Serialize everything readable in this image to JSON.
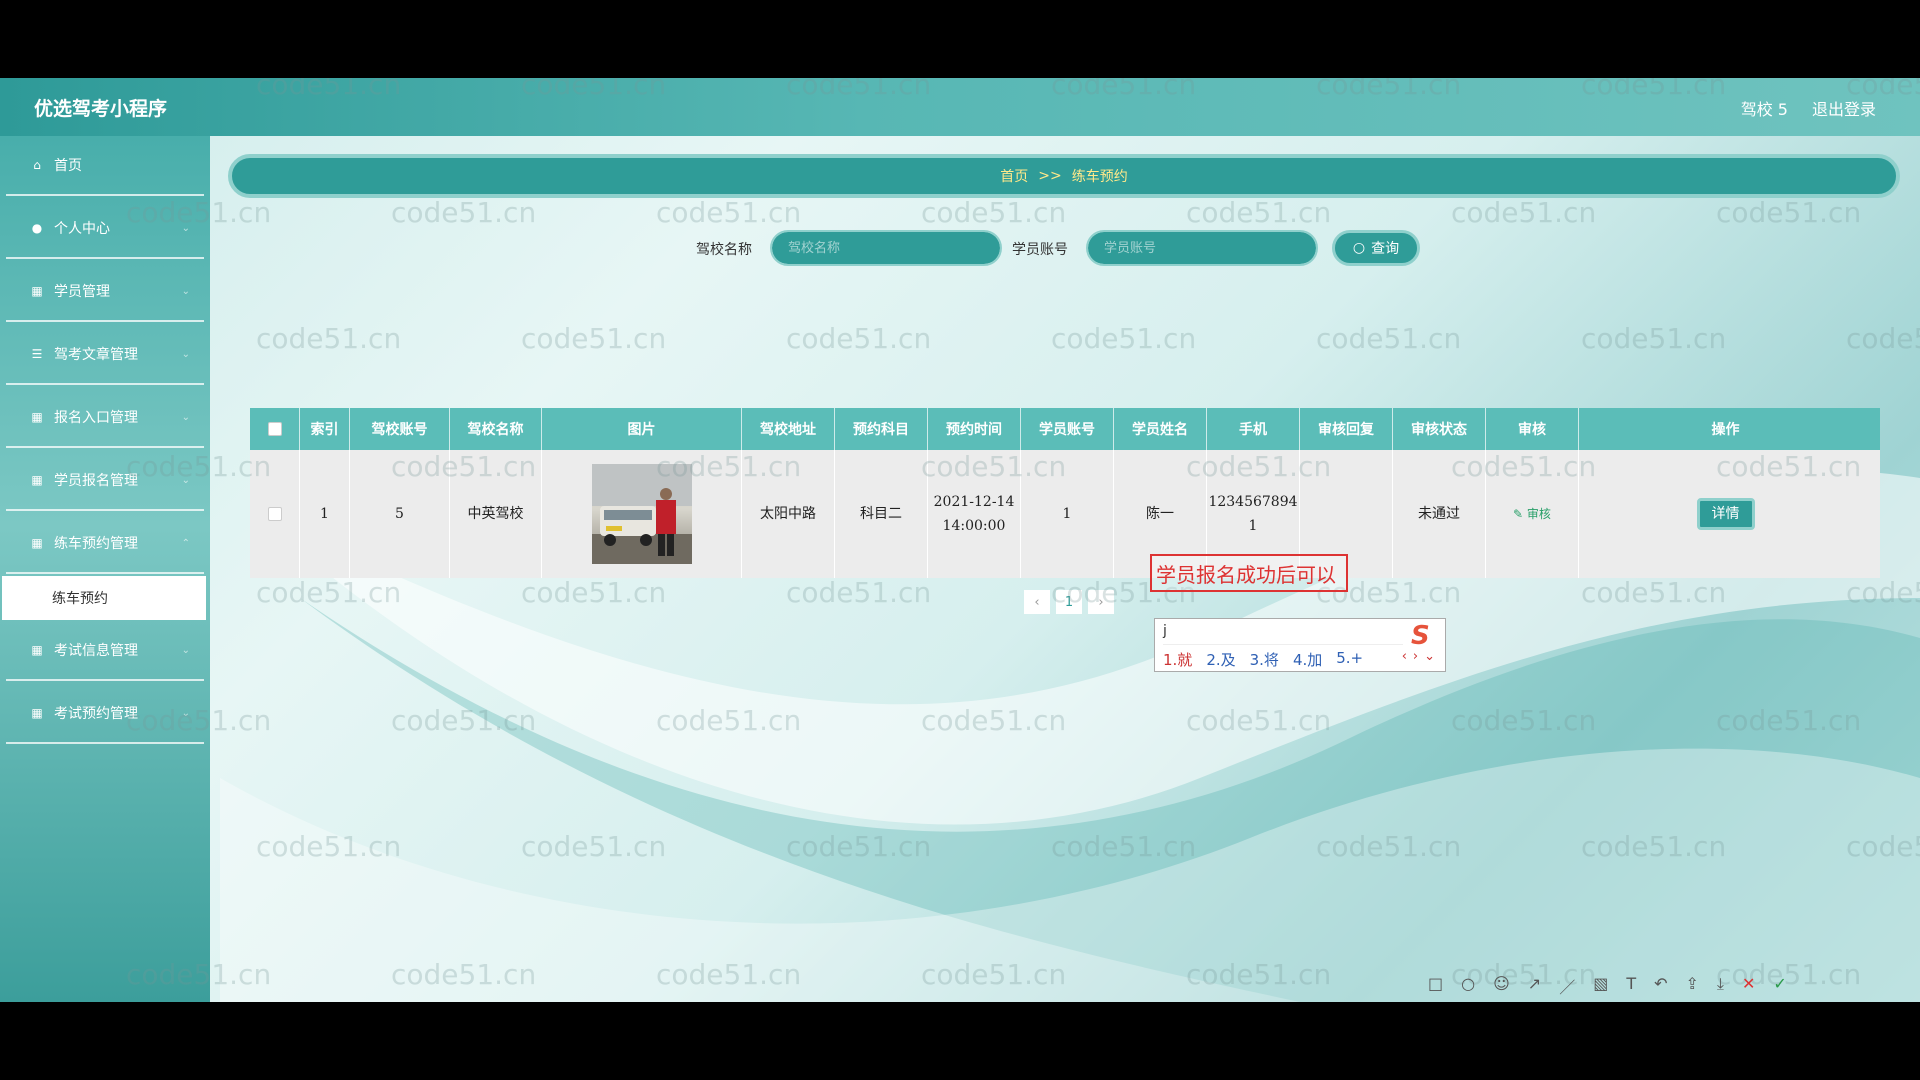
{
  "app": {
    "brand": "优选驾考小程序",
    "user": "驾校 5",
    "logout": "退出登录"
  },
  "sidebar": {
    "items": [
      {
        "label": "首页",
        "icon": "home-icon"
      },
      {
        "label": "个人中心",
        "icon": "user-icon"
      },
      {
        "label": "学员管理",
        "icon": "grid-icon"
      },
      {
        "label": "驾考文章管理",
        "icon": "sliders-icon"
      },
      {
        "label": "报名入口管理",
        "icon": "grid-icon"
      },
      {
        "label": "学员报名管理",
        "icon": "grid-icon"
      },
      {
        "label": "练车预约管理",
        "icon": "grid-icon"
      },
      {
        "label": "考试信息管理",
        "icon": "grid-icon"
      },
      {
        "label": "考试预约管理",
        "icon": "grid-icon"
      }
    ],
    "active_sub": "练车预约"
  },
  "breadcrumb": {
    "home": "首页",
    "sep": ">>",
    "current": "练车预约"
  },
  "search": {
    "school_label": "驾校名称",
    "school_placeholder": "驾校名称",
    "student_label": "学员账号",
    "student_placeholder": "学员账号",
    "query_label": "查询"
  },
  "table": {
    "headers": [
      "索引",
      "驾校账号",
      "驾校名称",
      "图片",
      "驾校地址",
      "预约科目",
      "预约时间",
      "学员账号",
      "学员姓名",
      "手机",
      "审核回复",
      "审核状态",
      "审核",
      "操作"
    ],
    "row": {
      "index": "1",
      "school_account": "5",
      "school_name": "中英驾校",
      "address": "太阳中路",
      "subject": "科目二",
      "time_date": "2021-12-14",
      "time_clock": "14:00:00",
      "student_account": "1",
      "student_name": "陈一",
      "phone_1": "1234567894",
      "phone_2": "1",
      "reply": "",
      "status": "未通过",
      "audit_link": "审核",
      "detail_btn": "详情"
    }
  },
  "pager": {
    "prev": "‹",
    "page": "1",
    "next": "›"
  },
  "overlay": {
    "annotation": "学员报名成功后可以",
    "ime_input": "j",
    "ime_candidates": [
      "1.就",
      "2.及",
      "3.将",
      "4.加",
      "5.+"
    ]
  },
  "watermark": "code51.cn",
  "colors": {
    "accent": "#2f9c98",
    "header": "#5bbdb8",
    "danger": "#dd3333"
  }
}
